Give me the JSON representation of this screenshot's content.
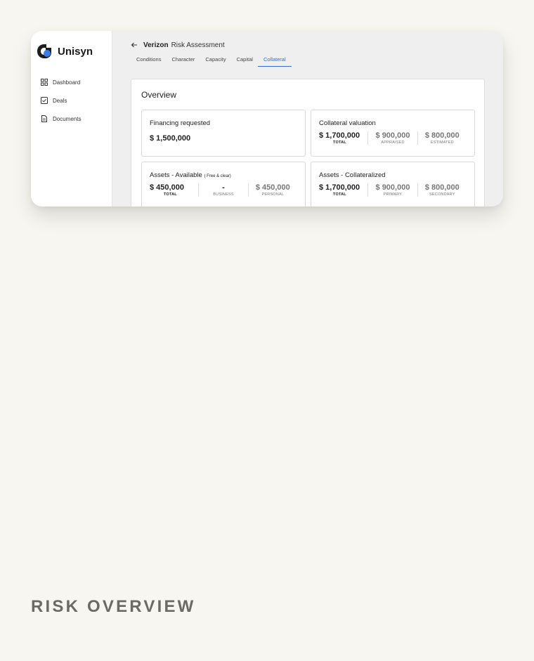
{
  "brand": {
    "name": "Unisyn",
    "icon": "unisyn-logo"
  },
  "sidebar": {
    "items": [
      {
        "label": "Dashboard",
        "icon": "grid-icon"
      },
      {
        "label": "Deals",
        "icon": "checkbox-icon"
      },
      {
        "label": "Documents",
        "icon": "document-icon"
      }
    ]
  },
  "header": {
    "company": "Verizon",
    "title": "Risk Assessment",
    "back_icon": "arrow-left-icon"
  },
  "tabs": [
    {
      "label": "Conditions",
      "active": false
    },
    {
      "label": "Character",
      "active": false
    },
    {
      "label": "Capacity",
      "active": false
    },
    {
      "label": "Capital",
      "active": false
    },
    {
      "label": "Collateral",
      "active": true
    }
  ],
  "overview": {
    "title": "Overview",
    "financing": {
      "title": "Financing requested",
      "value": "$ 1,500,000"
    },
    "collateral_valuation": {
      "title": "Collateral valuation",
      "stats": [
        {
          "value": "$ 1,700,000",
          "label": "TOTAL"
        },
        {
          "value": "$ 900,000",
          "label": "APPRAISED"
        },
        {
          "value": "$ 800,000",
          "label": "ESTIMATED"
        }
      ]
    },
    "assets_available": {
      "title": "Assets - Available",
      "note": "( Free & clear)",
      "stats": [
        {
          "value": "$ 450,000",
          "label": "TOTAL"
        },
        {
          "value": "-",
          "label": "BUSINESS"
        },
        {
          "value": "$ 450,000",
          "label": "PERSONAL"
        }
      ]
    },
    "assets_collateralized": {
      "title": "Assets - Collateralized",
      "stats": [
        {
          "value": "$ 1,700,000",
          "label": "TOTAL"
        },
        {
          "value": "$ 900,000",
          "label": "PRIMARY"
        },
        {
          "value": "$ 800,000",
          "label": "SECONDARY"
        }
      ]
    }
  },
  "caption": "RISK OVERVIEW",
  "colors": {
    "accent": "#2a6fd1",
    "background": "#f8f6f1",
    "logo_blue": "#3b7de8"
  }
}
